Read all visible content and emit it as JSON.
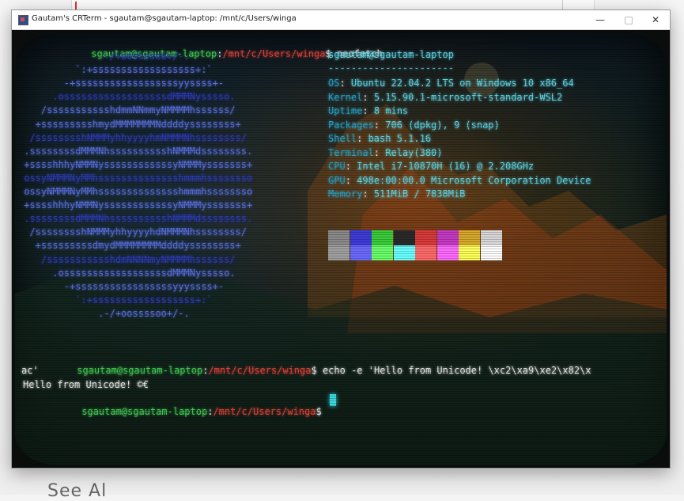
{
  "window": {
    "title": "Gautam's CRTerm - sgautam@sgautam-laptop: /mnt/c/Users/winga",
    "minimize_glyph": "—",
    "maximize_glyph": "□",
    "close_glyph": "✕"
  },
  "background_app": {
    "partial_text": "See Al"
  },
  "prompt": {
    "user_host": "sgautam@sgautam-laptop",
    "path": "/mnt/c/Users/winga",
    "symbol": "$"
  },
  "commands": [
    {
      "text": " neofetch"
    },
    {
      "text": " echo -e 'Hello from Unicode! \\xc2\\xa9\\xe2\\x82\\x",
      "continuation": "ac'"
    },
    {
      "text": " "
    }
  ],
  "output": {
    "hello_line": "Hello from Unicode! ©€"
  },
  "neofetch": {
    "header": "sgautam@sgautam-laptop",
    "separator": "----------------------",
    "info": [
      {
        "key": "OS",
        "value": "Ubuntu 22.04.2 LTS on Windows 10 x86_64"
      },
      {
        "key": "Kernel",
        "value": "5.15.90.1-microsoft-standard-WSL2"
      },
      {
        "key": "Uptime",
        "value": "8 mins"
      },
      {
        "key": "Packages",
        "value": "706 (dpkg), 9 (snap)"
      },
      {
        "key": "Shell",
        "value": "bash 5.1.16"
      },
      {
        "key": "Terminal",
        "value": "Relay(380)"
      },
      {
        "key": "CPU",
        "value": "Intel i7-10870H (16) @ 2.208GHz"
      },
      {
        "key": "GPU",
        "value": "498e:00:00.0 Microsoft Corporation Device"
      },
      {
        "key": "Memory",
        "value": "511MiB / 7838MiB"
      }
    ],
    "logo": [
      "              .-/+oossssoo+/-.",
      "          `:+ssssssssssssssssss+:`",
      "        -+ssssssssssssssssssyyssss+-",
      "      .ossssssssssssssssssdMMMNysssso.",
      "    /ssssssssssshdmmNNmmyNMMMMhssssss/",
      "   +ssssssssshmydMMMMMMMNddddyssssssss+",
      "  /sssssssshNMMMyhhyyyyhmNMMMNhssssssss/",
      " .ssssssssdMMMNhsssssssssshNMMMdssssssss.",
      " +sssshhhyNMMNyssssssssssssyNMMMysssssss+",
      " ossyNMMMNyMMhsssssssssssssshmmmhssssssso",
      " ossyNMMMNyMMhsssssssssssssshmmmhssssssso",
      " +sssshhhyNMMNyssssssssssssyNMMMysssssss+",
      " .ssssssssdMMMNhsssssssssshNMMMdssssssss.",
      "  /sssssssshNMMMyhhyyyyhdNMMMNhssssssss/",
      "   +sssssssssdmydMMMMMMMMddddyssssssss+",
      "    /ssssssssssshdmNNNNmyNMMMMhssssss/",
      "      .ossssssssssssssssssdMMMNysssso.",
      "        -+sssssssssssssssssyyyssss+-",
      "          `:+ssssssssssssssssss+:`",
      "              .-/+oossssoo+/-."
    ],
    "palette": {
      "top": [
        "#8a8a8a",
        "#3c3cd8",
        "#3acc3a",
        "#2a2a2a",
        "#d83a3a",
        "#c43ac4",
        "#d8a82a",
        "#d8d8d8"
      ],
      "bottom": [
        "#a0a0a0",
        "#6a6aff",
        "#6aff6a",
        "#6affff",
        "#ff6a6a",
        "#ff6aff",
        "#ffff5a",
        "#ffffff"
      ]
    }
  },
  "colors": {
    "prompt_user": "#44cc55",
    "prompt_path": "#e0443a",
    "info_key": "#2aa3c8",
    "info_value": "#5fd6e6",
    "cursor": "#39d7e0"
  }
}
